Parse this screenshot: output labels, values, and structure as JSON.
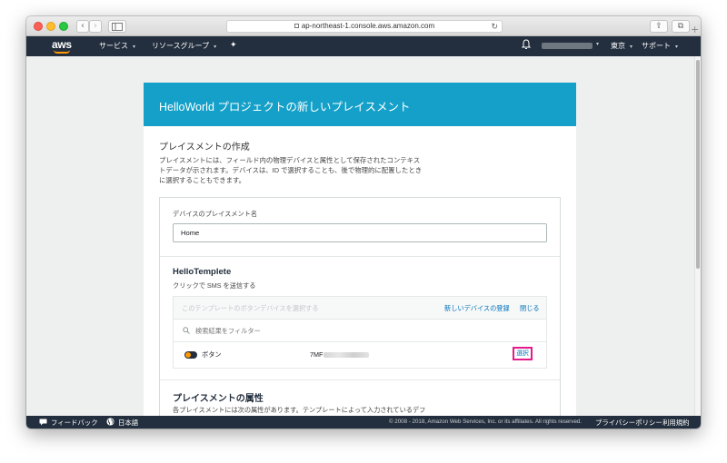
{
  "browser": {
    "address": "ap-northeast-1.console.aws.amazon.com",
    "reload_glyph": "↻",
    "back_glyph": "‹",
    "forward_glyph": "›",
    "share_glyph": "⇪",
    "tabs_glyph": "⧉",
    "plus_glyph": "+"
  },
  "awsnav": {
    "logo": "aws",
    "services": "サービス",
    "resource_groups": "リソースグループ",
    "pin_icon": "✦",
    "region": "東京",
    "support": "サポート",
    "caret": "▾"
  },
  "card": {
    "title": "HelloWorld プロジェクトの新しいプレイスメント",
    "section_title": "プレイスメントの作成",
    "description": "プレイスメントには、フィールド内の物理デバイスと属性として保存されたコンテキストデータが示されます。デバイスは、ID で選択することも、後で物理的に配置したときに選択することもできます。",
    "field_label": "デバイスのプレイスメント名",
    "field_value": "Home",
    "template_title": "HelloTemplete",
    "template_sub": "クリックで  SMS を送信する",
    "device_hint": "このテンプレートのボタンデバイスを選択する",
    "register_link": "新しいデバイスの登録",
    "close_link": "閉じる",
    "filter_placeholder": "検索結果をフィルター",
    "device_name": "ボタン",
    "device_serial_prefix": "7MF",
    "select_button": "選択",
    "attr_title": "プレイスメントの属性",
    "attr_desc": "各プレイスメントには次の属性があります。テンプレートによって入力されているデフ"
  },
  "footer": {
    "feedback": "フィードバック",
    "language": "日本語",
    "copyright": "© 2008 - 2018, Amazon Web Services, Inc. or its affiliates. All rights reserved.",
    "privacy": "プライバシーポリシー",
    "terms": "利用規約"
  },
  "colors": {
    "header_blue": "#14a0c8",
    "aws_navy": "#232f3e",
    "aws_orange": "#ff9900",
    "link_blue": "#0073bb",
    "highlight_pink": "#e5198a"
  }
}
